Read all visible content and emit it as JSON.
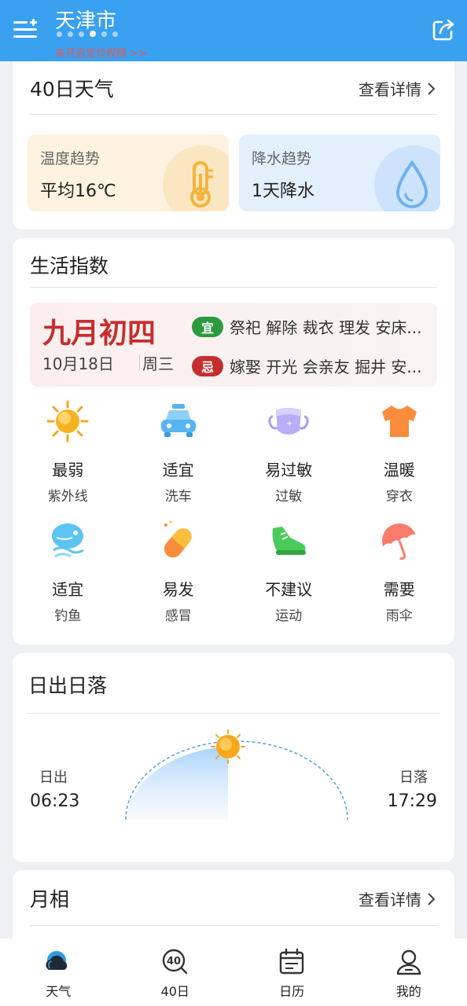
{
  "header": {
    "city": "天津市",
    "location_tip": "未开启定位权限 >>",
    "page_dots": 6,
    "active_dot": 3,
    "colors": {
      "bar": "#3aa0f0",
      "tip": "#e8574e"
    }
  },
  "forecast40": {
    "title": "40日天气",
    "more_label": "查看详情",
    "temperature": {
      "label": "温度趋势",
      "value": "平均16℃",
      "icon": "thermometer-icon"
    },
    "precipitation": {
      "label": "降水趋势",
      "value": "1天降水",
      "icon": "water-drop-icon"
    }
  },
  "life": {
    "title": "生活指数",
    "almanac": {
      "lunar_date": "九月初四",
      "solar_date": "10月18日",
      "weekday": "周三",
      "yi_badge": "宜",
      "yi_text": "祭祀 解除 裁衣 理发 安床...",
      "ji_badge": "忌",
      "ji_text": "嫁娶 开光 会亲友 掘井 安..."
    },
    "items": [
      {
        "value": "最弱",
        "name": "紫外线",
        "icon": "sun-uv-icon"
      },
      {
        "value": "适宜",
        "name": "洗车",
        "icon": "car-wash-icon"
      },
      {
        "value": "易过敏",
        "name": "过敏",
        "icon": "mask-icon"
      },
      {
        "value": "温暖",
        "name": "穿衣",
        "icon": "tshirt-icon"
      },
      {
        "value": "适宜",
        "name": "钓鱼",
        "icon": "fish-icon"
      },
      {
        "value": "易发",
        "name": "感冒",
        "icon": "pill-icon"
      },
      {
        "value": "不建议",
        "name": "运动",
        "icon": "sneaker-icon"
      },
      {
        "value": "需要",
        "name": "雨伞",
        "icon": "umbrella-icon"
      }
    ]
  },
  "sun": {
    "title": "日出日落",
    "sunrise_label": "日出",
    "sunrise_time": "06:23",
    "sunset_label": "日落",
    "sunset_time": "17:29"
  },
  "moon": {
    "title": "月相",
    "more_label": "查看详情"
  },
  "tabs": [
    {
      "label": "天气",
      "icon": "cloud-weather-icon",
      "active": true
    },
    {
      "label": "40日",
      "icon": "forty-day-icon",
      "active": false
    },
    {
      "label": "日历",
      "icon": "calendar-icon",
      "active": false
    },
    {
      "label": "我的",
      "icon": "profile-icon",
      "active": false
    }
  ]
}
